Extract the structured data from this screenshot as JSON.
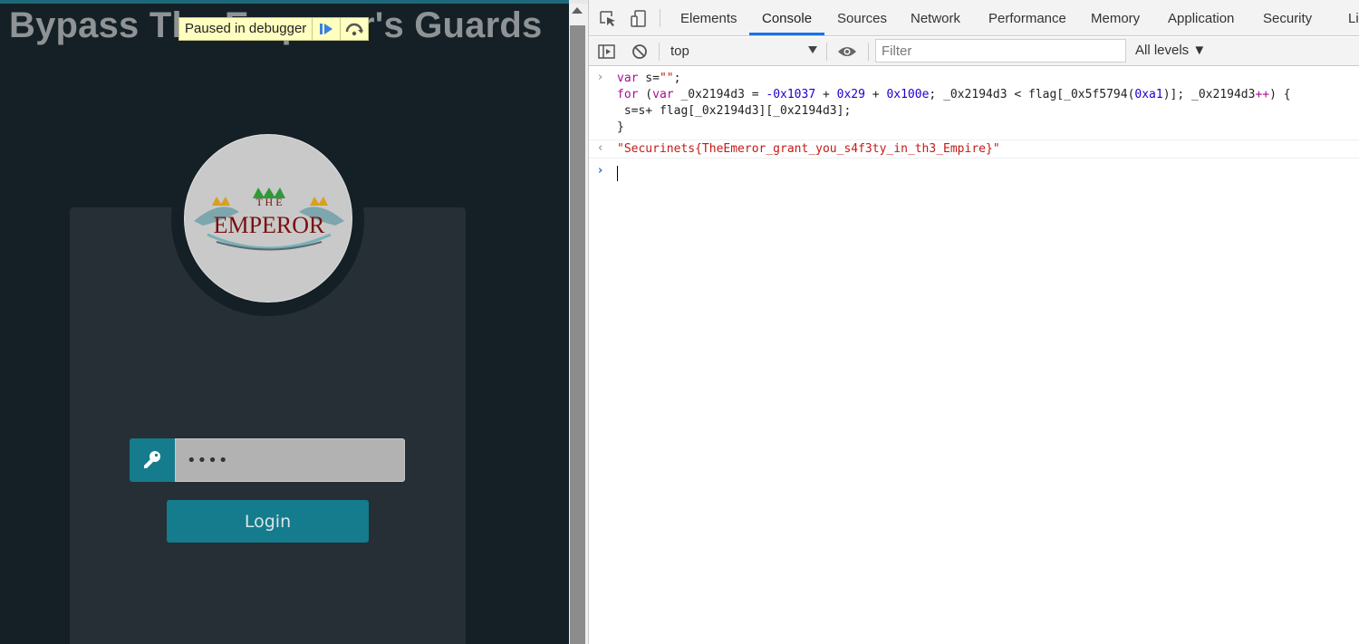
{
  "page": {
    "title": "Bypass The Emperor's Guards",
    "debugger_message": "Paused in debugger",
    "password_value": "••••",
    "login_label": "Login"
  },
  "devtools": {
    "tabs": [
      "Elements",
      "Console",
      "Sources",
      "Network",
      "Performance",
      "Memory",
      "Application",
      "Security",
      "Li"
    ],
    "active_tab": "Console",
    "context": "top",
    "filter_placeholder": "Filter",
    "levels": "All levels ▼",
    "console": {
      "input_lines": [
        "var s=\"\";",
        "for (var _0x2194d3 = -0x1037 + 0x29 + 0x100e; _0x2194d3 < flag[_0x5f5794(0xa1)]; _0x2194d3++) {",
        " s=s+ flag[_0x2194d3][_0x2194d3];",
        "}"
      ],
      "result": "\"Securinets{TheEmeror_grant_you_s4f3ty_in_th3_Empire}\""
    }
  },
  "colors": {
    "page_bg": "#142026",
    "card_bg": "#252f35",
    "accent": "#147c8c",
    "debugger_bg": "#ffffc0",
    "tab_highlight": "#1a73e8"
  }
}
